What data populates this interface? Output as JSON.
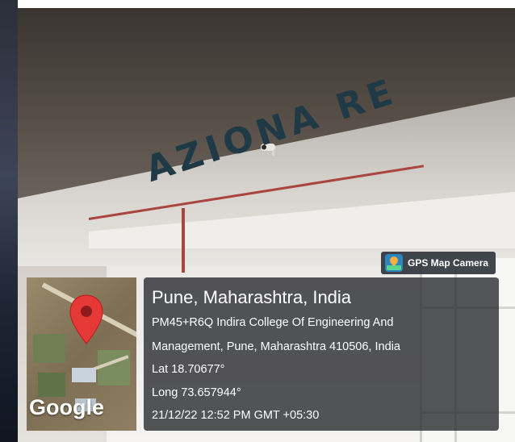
{
  "scene": {
    "sign_text": "AZIONA RE"
  },
  "overlay": {
    "app_badge": {
      "label": "GPS Map Camera",
      "icon": "gps-map-camera-app-icon"
    },
    "map": {
      "attribution": "Google",
      "marker_icon": "map-pin-icon",
      "marker_color": "#e53935"
    },
    "location": {
      "title": "Pune, Maharashtra, India",
      "address_line1": "PM45+R6Q Indira College Of Engineering And",
      "address_line2": "Management, Pune, Maharashtra 410506, India",
      "latitude": "Lat 18.70677°",
      "longitude": "Long 73.657944°",
      "timestamp": "21/12/22 12:52 PM GMT +05:30"
    }
  }
}
